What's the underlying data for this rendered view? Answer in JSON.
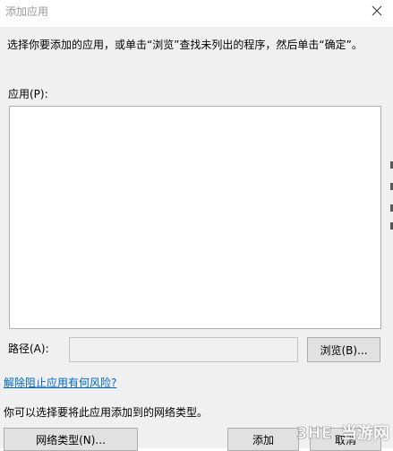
{
  "window": {
    "title": "添加应用"
  },
  "instruction": "选择你要添加的应用，或单击“浏览”查找未列出的程序，然后单击“确定”。",
  "apps": {
    "label": "应用(P):",
    "items": []
  },
  "path": {
    "label": "路径(A):",
    "value": "",
    "browse_label": "浏览(B)..."
  },
  "risk_link": "解除阻止应用有何风险?",
  "network": {
    "text": "你可以选择要将此应用添加到的网络类型。",
    "button_label": "网络类型(N)..."
  },
  "footer": {
    "ok_label": "添加",
    "cancel_label": "取消"
  },
  "watermark": {
    "text": "当游网"
  },
  "colors": {
    "dialog_bg": "#f0f0f0",
    "link": "#0066cc",
    "button_bg": "#e1e1e1",
    "border": "#adadad"
  }
}
